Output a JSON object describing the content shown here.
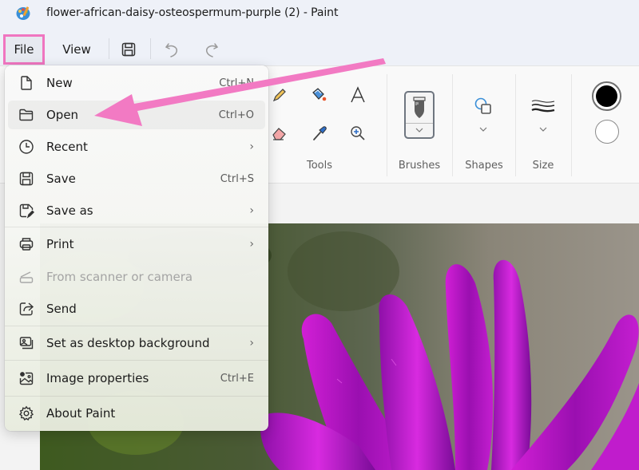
{
  "window": {
    "title": "flower-african-daisy-osteospermum-purple (2) - Paint",
    "app_icon": "paint-palette-icon"
  },
  "menubar": {
    "file_label": "File",
    "view_label": "View",
    "save_icon": "save-icon",
    "undo_icon": "undo-icon",
    "redo_icon": "redo-icon"
  },
  "ribbon": {
    "groups": {
      "tools_label": "Tools",
      "brushes_label": "Brushes",
      "shapes_label": "Shapes",
      "size_label": "Size"
    },
    "tools": [
      "pencil",
      "fill",
      "text",
      "eraser",
      "color-picker",
      "magnifier"
    ],
    "colors": {
      "primary": "#000000",
      "secondary": "#ffffff"
    }
  },
  "file_menu": {
    "items": [
      {
        "label": "New",
        "shortcut": "Ctrl+N",
        "icon": "new-file-icon"
      },
      {
        "label": "Open",
        "shortcut": "Ctrl+O",
        "icon": "folder-open-icon",
        "highlighted": true
      },
      {
        "label": "Recent",
        "submenu": true,
        "icon": "clock-icon"
      },
      {
        "label": "Save",
        "shortcut": "Ctrl+S",
        "icon": "save-icon"
      },
      {
        "label": "Save as",
        "submenu": true,
        "icon": "save-as-icon"
      },
      {
        "label": "Print",
        "submenu": true,
        "icon": "printer-icon"
      },
      {
        "label": "From scanner or camera",
        "disabled": true,
        "icon": "scanner-icon"
      },
      {
        "label": "Send",
        "icon": "share-icon"
      },
      {
        "label": "Set as desktop background",
        "submenu": true,
        "icon": "desktop-background-icon"
      },
      {
        "label": "Image properties",
        "shortcut": "Ctrl+E",
        "icon": "image-properties-icon"
      },
      {
        "label": "About Paint",
        "icon": "gear-icon"
      }
    ],
    "submenu_glyph": "›"
  },
  "annotation": {
    "type": "arrow",
    "color": "#f27ac3",
    "points_to": "Open"
  },
  "canvas": {
    "content": "purple african daisy photo"
  }
}
